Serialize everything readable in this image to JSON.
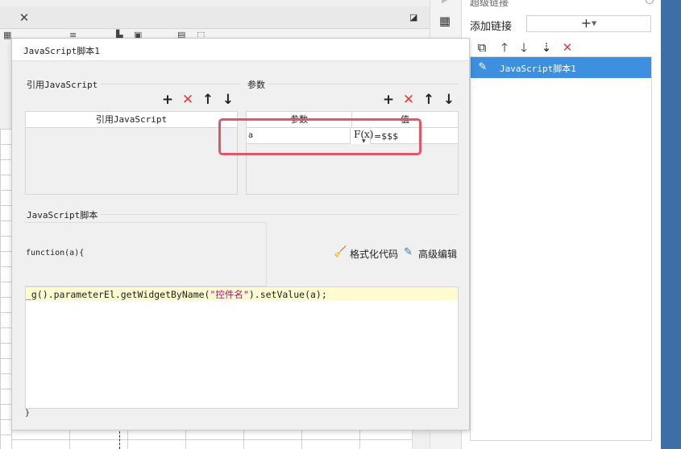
{
  "dialog": {
    "title": "JavaScript脚本1",
    "references": {
      "section_label": "引用JavaScript",
      "column_header": "引用JavaScript"
    },
    "params": {
      "section_label": "参数",
      "columns": [
        "参数",
        "值"
      ],
      "rows": [
        {
          "name": "a",
          "formula_label": "F(x)",
          "value": "=$$$"
        }
      ]
    },
    "script": {
      "section_label": "JavaScript脚本",
      "function_open": "function(a){",
      "function_close": "}",
      "code_prefix": "_g().parameterEl.getWidgetByName(",
      "code_string": "\"控件名\"",
      "code_suffix": ").setValue(a);",
      "format_label": "格式化代码",
      "advanced_label": "高级编辑"
    }
  },
  "right_panel": {
    "header_clip": "超级链接",
    "add_link_label": "添加链接",
    "add_button_glyph": "+",
    "items": [
      {
        "label": "JavaScript脚本1",
        "selected": true
      }
    ]
  },
  "colors": {
    "selection": "#3d8fe0",
    "delete_red": "#e23b3b",
    "highlight_border": "#e2566a",
    "code_line_bg": "#fffbd0",
    "code_string": "#a0136e",
    "side_band": "#3d6ea8"
  },
  "icons": {
    "add": "plus-icon",
    "delete": "delete-x-icon",
    "move_up": "arrow-up-icon",
    "move_down": "arrow-down-icon",
    "format": "broom-icon",
    "advanced": "edit-icon",
    "copy": "copy-icon",
    "item": "pencil-icon"
  }
}
